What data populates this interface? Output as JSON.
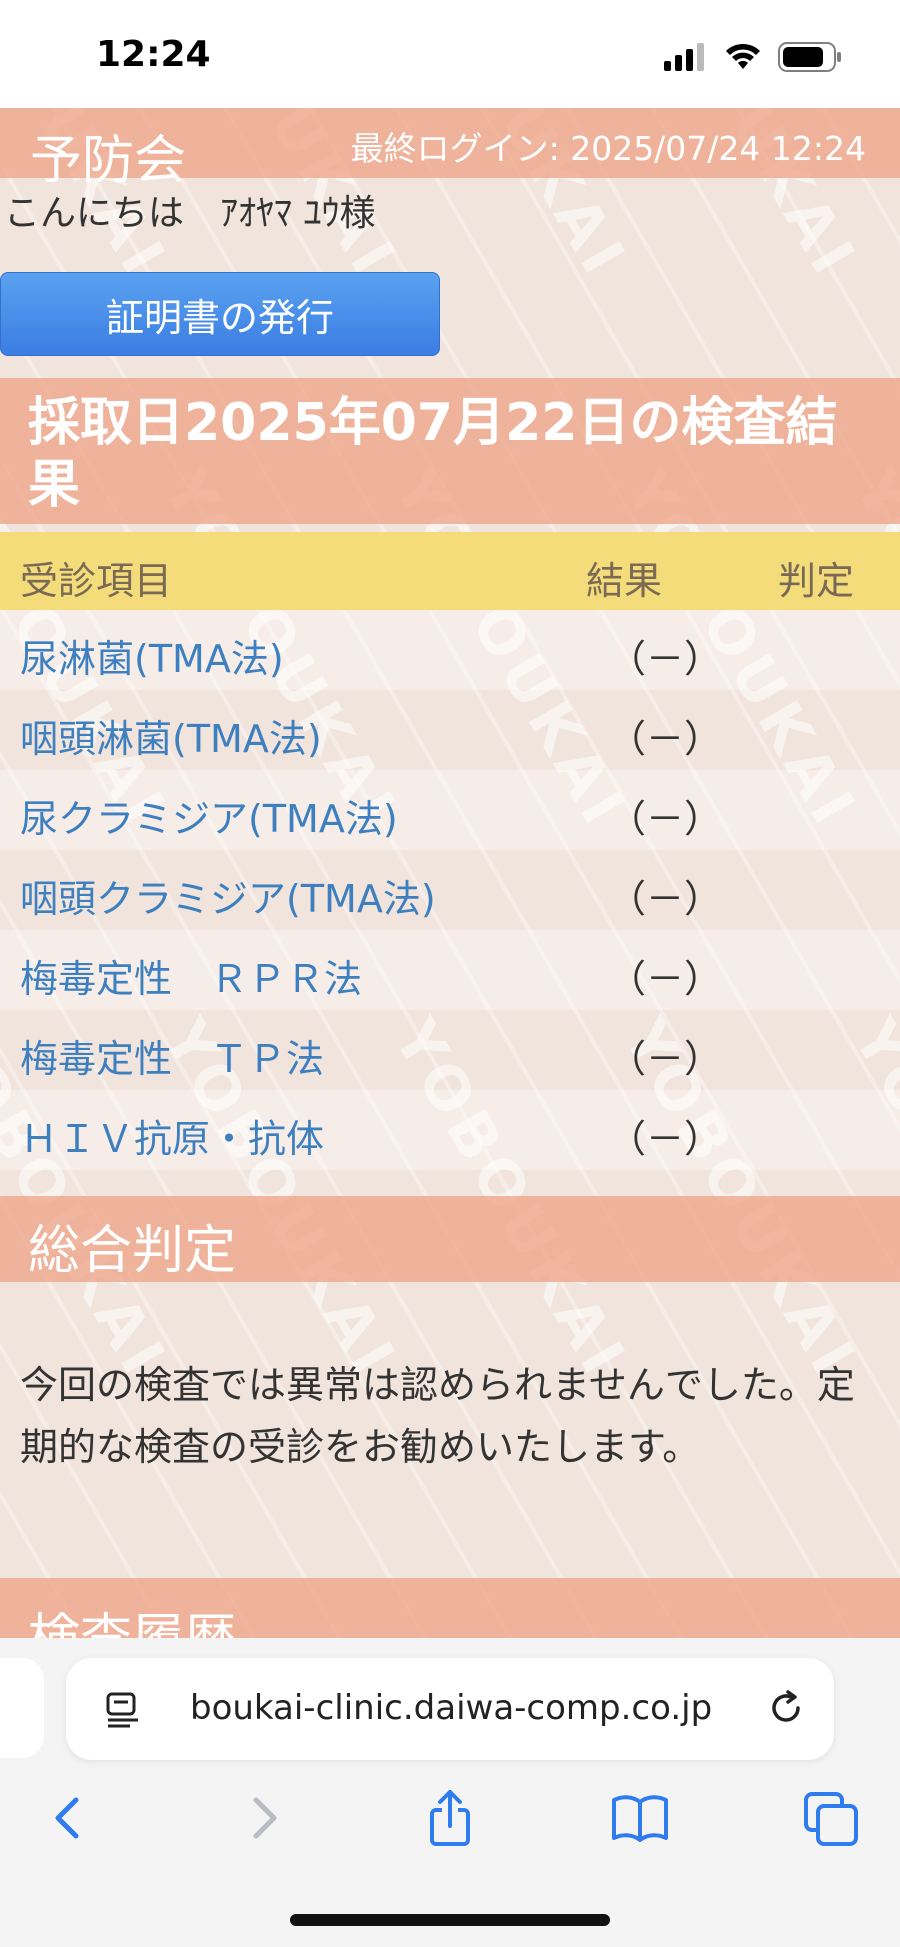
{
  "status_bar": {
    "time": "12:24"
  },
  "header": {
    "site_title": "予防会",
    "last_login": "最終ログイン: 2025/07/24 12:24"
  },
  "greeting": "こんにちは　ｱｵﾔﾏ ﾕｳ様",
  "cert_button_label": "証明書の発行",
  "results": {
    "title": "採取日2025年07月22日の検査結果",
    "columns": {
      "item": "受診項目",
      "result": "結果",
      "judgement": "判定"
    },
    "rows": [
      {
        "item": "尿淋菌(TMA法)",
        "result": "（－）"
      },
      {
        "item": "咽頭淋菌(TMA法)",
        "result": "（－）"
      },
      {
        "item": "尿クラミジア(TMA法)",
        "result": "（－）"
      },
      {
        "item": "咽頭クラミジア(TMA法)",
        "result": "（－）"
      },
      {
        "item": "梅毒定性　ＲＰＲ法",
        "result": "（－）"
      },
      {
        "item": "梅毒定性　ＴＰ法",
        "result": "（－）"
      },
      {
        "item": "ＨＩＶ抗原・抗体",
        "result": "（－）"
      }
    ]
  },
  "overall": {
    "title": "総合判定",
    "text": "今回の検査では異常は認められませんでした。定期的な検査の受診をお勧めいたします。"
  },
  "history": {
    "title": "検査履歴"
  },
  "watermark": "YOBOUKAI",
  "browser": {
    "url": "boukai-clinic.daiwa-comp.co.jp"
  }
}
